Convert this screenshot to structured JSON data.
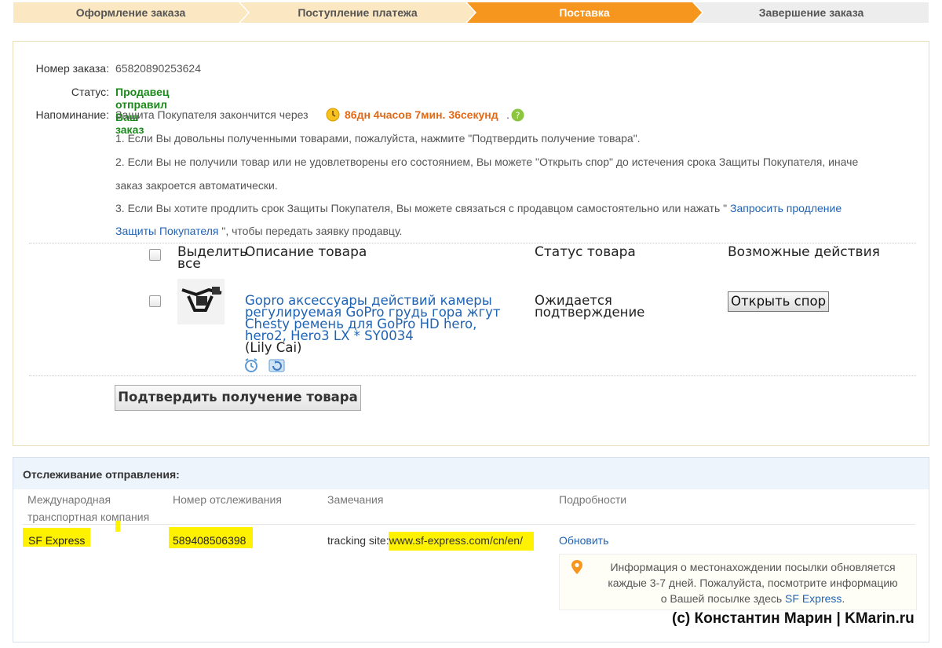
{
  "steps": [
    "Оформление заказа",
    "Поступление платежа",
    "Поставка",
    "Завершение заказа"
  ],
  "order": {
    "number_label": "Номер заказа:",
    "number": "65820890253624",
    "status_label": "Статус:",
    "status": "Продавец отправил Ваш заказ",
    "reminder_label": "Напоминание:",
    "reminder_prefix": "Защита Покупателя закончится через",
    "countdown": "86дн 4часов 7мин. 36секунд",
    "countdown_suffix": ".",
    "note1": "1. Если Вы довольны полученными товарами, пожалуйста, нажмите \"Подтвердить получение товара\".",
    "note2a": "2. Если Вы не получили товар или не удовлетворены его состоянием, Вы можете \"Открыть спор\" до истечения срока Защиты Покупателя, иначе",
    "note2b": "заказ закроется автоматически.",
    "note3a": "3. Если Вы хотите продлить срок Защиты Покупателя, Вы можете связаться с продавцом самостоятельно или нажать \"",
    "note3_link_a": "Запросить продление",
    "note3_link_b": "Защиты Покупателя",
    "note3b": "\", чтобы передать заявку продавцу."
  },
  "table": {
    "col_select": "Выделить все",
    "col_select_a": "Выделить",
    "col_select_b": "все",
    "col_desc": "Описание товара",
    "col_status": "Статус товара",
    "col_actions": "Возможные действия",
    "item": {
      "title_l1": "Gopro аксессуары действий камеры",
      "title_l2": "регулируемая GoPro грудь гора жгут",
      "title_l3": "Chesty ремень для GoPro HD hero,",
      "title_l4": "hero2, Hero3 LX * SY0034",
      "seller": "(Lily Cai)",
      "status_l1": "Ожидается",
      "status_l2": "подтверждение",
      "action": "Открыть спор"
    }
  },
  "confirm_button": "Подтвердить получение товара",
  "tracking": {
    "title": "Отслеживание отправления:",
    "col_company_l1": "Международная",
    "col_company_l2": "транспортная компания",
    "col_number": "Номер отслеживания",
    "col_notes": "Замечания",
    "col_details": "Подробности",
    "company": "SF Express",
    "number": "589408506398",
    "notes_prefix": "tracking site:",
    "notes_url": "www.sf-express.com/cn/en/",
    "refresh": "Обновить",
    "info_l1": "Информация о местонахождении посылки обновляется",
    "info_l2": "каждые 3-7 дней. Пожалуйста, посмотрите информацию",
    "info_l3a": "о Вашей посылке здесь",
    "info_link": "SF Express",
    "info_l3b": "."
  },
  "copyright": "(c) Константин Марин | KMarin.ru",
  "colors": {
    "accent": "#f6961e",
    "link": "#1f63b4",
    "status_green": "#1b8a1b",
    "countdown": "#e06a17",
    "highlight": "#fff200"
  }
}
